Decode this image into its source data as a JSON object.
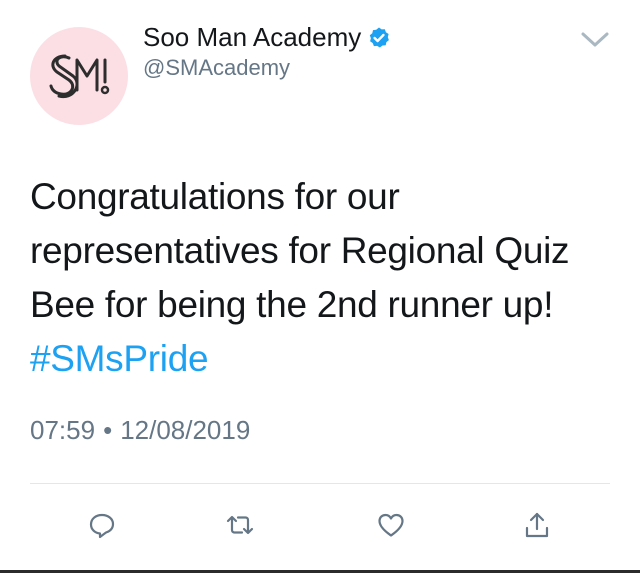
{
  "author": {
    "display_name": "Soo Man Academy",
    "handle": "@SMAcademy",
    "verified": true,
    "avatar_icon": "sm-logo-icon"
  },
  "tweet": {
    "text_plain": "Congratulations for our representatives for Regional Quiz Bee for being the 2nd runner up!",
    "hashtag": "#SMsPride",
    "time": "07:59",
    "separator": "•",
    "date": "12/08/2019"
  },
  "actions": [
    {
      "name": "reply",
      "icon": "reply-icon"
    },
    {
      "name": "retweet",
      "icon": "retweet-icon"
    },
    {
      "name": "like",
      "icon": "heart-icon"
    },
    {
      "name": "share",
      "icon": "share-icon"
    }
  ],
  "colors": {
    "accent": "#1da1f2",
    "text_primary": "#14171a",
    "text_secondary": "#657786",
    "avatar_bg": "#fbdfe4",
    "avatar_logo": "#2d2d2d",
    "divider": "#e1e8ed",
    "icon": "#657786"
  }
}
